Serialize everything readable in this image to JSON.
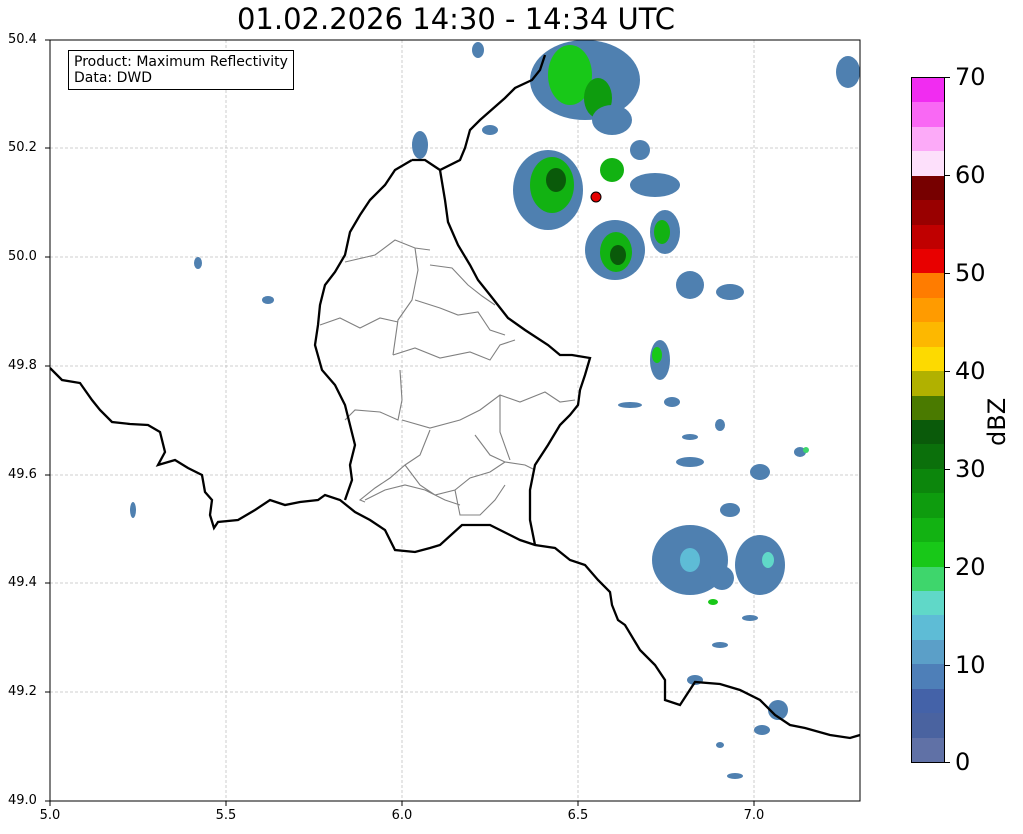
{
  "title": "01.02.2026 14:30 - 14:34 UTC",
  "info": {
    "product_line": "Product: Maximum Reflectivity",
    "data_line": "Data: DWD"
  },
  "axes": {
    "x_ticks": [
      "5.0",
      "5.5",
      "6.0",
      "6.5",
      "7.0"
    ],
    "y_ticks": [
      "50.4",
      "50.2",
      "50.0",
      "49.8",
      "49.6",
      "49.4",
      "49.2",
      "49.0"
    ],
    "lon_range": [
      5.0,
      7.3
    ],
    "lat_range": [
      49.0,
      50.4
    ]
  },
  "colorbar": {
    "unit": "dBZ",
    "labels": [
      "70",
      "60",
      "50",
      "40",
      "30",
      "20",
      "10",
      "0"
    ],
    "colors": [
      "#f12cf1",
      "#f968f4",
      "#fcaaf8",
      "#fde0fb",
      "#770000",
      "#990000",
      "#c00000",
      "#e80000",
      "#ff7c00",
      "#ff9b00",
      "#fdb800",
      "#fdda00",
      "#b1b100",
      "#4a7a00",
      "#0a5a0a",
      "#0b700b",
      "#0c860c",
      "#0e9c0e",
      "#12b212",
      "#18c818",
      "#3ed66c",
      "#60d8c8",
      "#5ebcd6",
      "#5b9fc8",
      "#4e7fb8",
      "#4462a8",
      "#4a63a0",
      "#6071a6"
    ]
  },
  "marker": {
    "lon": 6.55,
    "lat": 50.11,
    "color": "#e50000"
  },
  "colors": {
    "border": "#000000",
    "district": "#808080",
    "grid": "#c0c0c0"
  }
}
